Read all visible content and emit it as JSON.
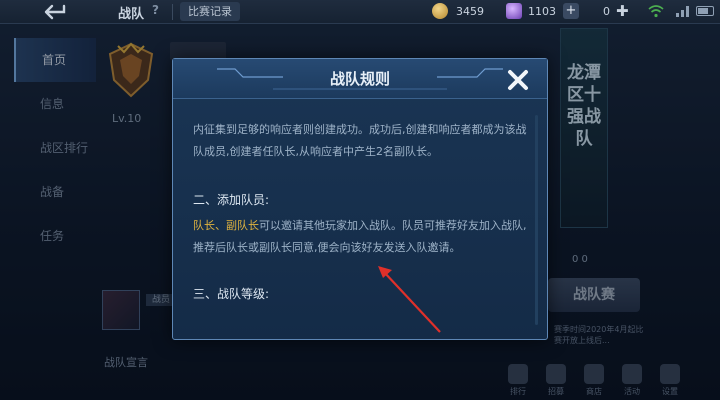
{
  "topbar": {
    "title": "战队",
    "help": "?",
    "records_label": "比赛记录",
    "coins": "3459",
    "gems": "1103",
    "add": "+",
    "secondary_value": "0"
  },
  "sidebar": {
    "items": [
      {
        "label": "首页",
        "active": true
      },
      {
        "label": "信息"
      },
      {
        "label": "战区排行"
      },
      {
        "label": "战备"
      },
      {
        "label": "任务"
      }
    ]
  },
  "team": {
    "level": "Lv.10",
    "member_tag": "战员",
    "declaration_label": "战队宣言"
  },
  "right_panel": {
    "region_title": "龙潭区十强战队",
    "trophy_counts": "0 0",
    "match_button": "战队赛",
    "match_note": "赛季时间2020年4月起比赛开放上线后..."
  },
  "bottom_nav": {
    "items": [
      "排行",
      "招募",
      "商店",
      "活动",
      "设置"
    ]
  },
  "modal": {
    "title": "战队规则",
    "para1": "内征集到足够的响应者则创建成功。成功后,创建和响应者都成为该战队成员,创建者任队长,从响应者中产生2名副队长。",
    "section2_heading": "二、添加队员:",
    "section2_highlight": "队长、副队长",
    "section2_text": "可以邀请其他玩家加入战队。队员可推荐好友加入战队,推荐后队长或副队长同意,便会向该好友发送入队邀请。",
    "section3_heading": "三、战队等级:"
  },
  "colors": {
    "highlight": "#e0b33f",
    "modal_border": "#5e87b5",
    "annotation": "#e0302a"
  }
}
